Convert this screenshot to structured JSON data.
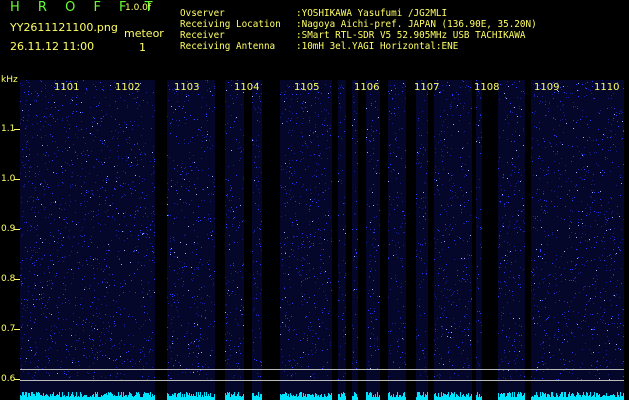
{
  "header": {
    "logo": "H R O F F T",
    "version": "1.0.0f",
    "filename": "YY2611121100.png",
    "timestamp": "26.11.12 11:00",
    "meteor_label": "meteor",
    "meteor_count": "1"
  },
  "info": [
    {
      "label": "Ovserver",
      "value": ":YOSHIKAWA Yasufumi /JG2MLI"
    },
    {
      "label": "Receiving Location",
      "value": ":Nagoya Aichi-pref. JAPAN (136.90E, 35.20N)"
    },
    {
      "label": "Receiver",
      "value": ":SMart RTL-SDR V5 52.905MHz USB TACHIKAWA"
    },
    {
      "label": "Receiving Antenna",
      "value": ":10mH 3el.YAGI Horizontal:ENE"
    }
  ],
  "axis": {
    "unit": "kHz",
    "y_ticks": [
      "1.1",
      "1.0",
      "0.9",
      "0.8",
      "0.7",
      "0.6"
    ],
    "x_ticks": [
      "1101",
      "1102",
      "1103",
      "1104",
      "1105",
      "1106",
      "1107",
      "1108",
      "1109",
      "1110"
    ]
  },
  "colors": {
    "label": "#ffff66",
    "logo": "#66ff33",
    "noise": "#2b3cff",
    "signal": "#00e5ff"
  }
}
